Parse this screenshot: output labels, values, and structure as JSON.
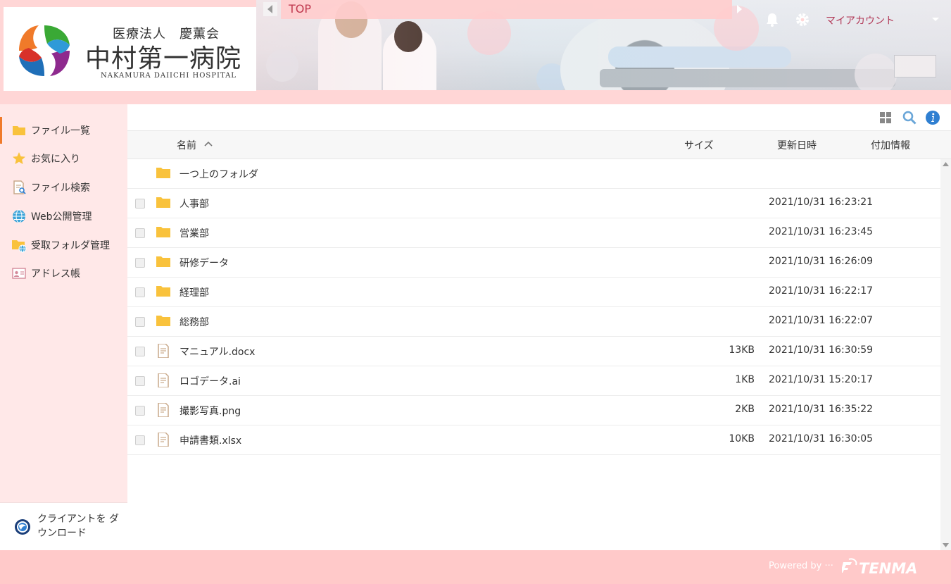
{
  "header": {
    "org": "医療法人　慶薫会",
    "hospital_name": "中村第一病院",
    "hospital_name_en": "NAKAMURA DAIICHI HOSPITAL",
    "top_label": "TOP",
    "account_label": "マイアカウント"
  },
  "sidebar": {
    "items": [
      {
        "label": "ファイル一覧",
        "icon": "folder-icon"
      },
      {
        "label": "お気に入り",
        "icon": "star-icon"
      },
      {
        "label": "ファイル検索",
        "icon": "file-search-icon"
      },
      {
        "label": "Web公開管理",
        "icon": "globe-icon"
      },
      {
        "label": "受取フォルダ管理",
        "icon": "folder-globe-icon"
      },
      {
        "label": "アドレス帳",
        "icon": "address-card-icon"
      }
    ],
    "client_download": "クライアントを ダウンロード"
  },
  "columns": {
    "name": "名前",
    "size": "サイズ",
    "updated": "更新日時",
    "extra": "付加情報"
  },
  "rows": [
    {
      "name": "一つ上のフォルダ",
      "type": "folder",
      "size": "",
      "date": ""
    },
    {
      "name": "人事部",
      "type": "folder",
      "size": "",
      "date": "2021/10/31 16:23:21"
    },
    {
      "name": "営業部",
      "type": "folder",
      "size": "",
      "date": "2021/10/31 16:23:45"
    },
    {
      "name": "研修データ",
      "type": "folder",
      "size": "",
      "date": "2021/10/31 16:26:09"
    },
    {
      "name": "経理部",
      "type": "folder",
      "size": "",
      "date": "2021/10/31 16:22:17"
    },
    {
      "name": "総務部",
      "type": "folder",
      "size": "",
      "date": "2021/10/31 16:22:07"
    },
    {
      "name": "マニュアル.docx",
      "type": "file",
      "size": "13KB",
      "date": "2021/10/31 16:30:59"
    },
    {
      "name": "ロゴデータ.ai",
      "type": "file",
      "size": "1KB",
      "date": "2021/10/31 15:20:17"
    },
    {
      "name": "撮影写真.png",
      "type": "file",
      "size": "2KB",
      "date": "2021/10/31 16:35:22"
    },
    {
      "name": "申請書類.xlsx",
      "type": "file",
      "size": "10KB",
      "date": "2021/10/31 16:30:05"
    }
  ],
  "footer": {
    "powered_by": "Powered by ···",
    "brand": "TENMA"
  },
  "colors": {
    "accent": "#c0394f",
    "folder": "#f9c23c",
    "active_marker": "#f07a2a"
  }
}
